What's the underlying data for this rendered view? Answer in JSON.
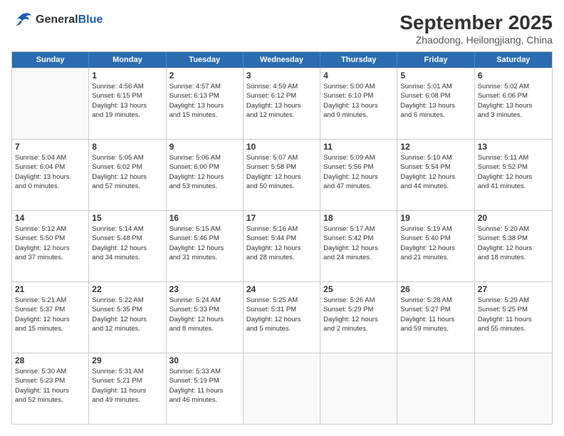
{
  "logo": {
    "general": "General",
    "blue": "Blue"
  },
  "title": "September 2025",
  "subtitle": "Zhaodong, Heilongjiang, China",
  "days_of_week": [
    "Sunday",
    "Monday",
    "Tuesday",
    "Wednesday",
    "Thursday",
    "Friday",
    "Saturday"
  ],
  "weeks": [
    [
      {
        "day": "",
        "info": ""
      },
      {
        "day": "1",
        "info": "Sunrise: 4:56 AM\nSunset: 6:15 PM\nDaylight: 13 hours\nand 19 minutes."
      },
      {
        "day": "2",
        "info": "Sunrise: 4:57 AM\nSunset: 6:13 PM\nDaylight: 13 hours\nand 15 minutes."
      },
      {
        "day": "3",
        "info": "Sunrise: 4:59 AM\nSunset: 6:12 PM\nDaylight: 13 hours\nand 12 minutes."
      },
      {
        "day": "4",
        "info": "Sunrise: 5:00 AM\nSunset: 6:10 PM\nDaylight: 13 hours\nand 9 minutes."
      },
      {
        "day": "5",
        "info": "Sunrise: 5:01 AM\nSunset: 6:08 PM\nDaylight: 13 hours\nand 6 minutes."
      },
      {
        "day": "6",
        "info": "Sunrise: 5:02 AM\nSunset: 6:06 PM\nDaylight: 13 hours\nand 3 minutes."
      }
    ],
    [
      {
        "day": "7",
        "info": "Sunrise: 5:04 AM\nSunset: 6:04 PM\nDaylight: 13 hours\nand 0 minutes."
      },
      {
        "day": "8",
        "info": "Sunrise: 5:05 AM\nSunset: 6:02 PM\nDaylight: 12 hours\nand 57 minutes."
      },
      {
        "day": "9",
        "info": "Sunrise: 5:06 AM\nSunset: 6:00 PM\nDaylight: 12 hours\nand 53 minutes."
      },
      {
        "day": "10",
        "info": "Sunrise: 5:07 AM\nSunset: 5:58 PM\nDaylight: 12 hours\nand 50 minutes."
      },
      {
        "day": "11",
        "info": "Sunrise: 5:09 AM\nSunset: 5:56 PM\nDaylight: 12 hours\nand 47 minutes."
      },
      {
        "day": "12",
        "info": "Sunrise: 5:10 AM\nSunset: 5:54 PM\nDaylight: 12 hours\nand 44 minutes."
      },
      {
        "day": "13",
        "info": "Sunrise: 5:11 AM\nSunset: 5:52 PM\nDaylight: 12 hours\nand 41 minutes."
      }
    ],
    [
      {
        "day": "14",
        "info": "Sunrise: 5:12 AM\nSunset: 5:50 PM\nDaylight: 12 hours\nand 37 minutes."
      },
      {
        "day": "15",
        "info": "Sunrise: 5:14 AM\nSunset: 5:48 PM\nDaylight: 12 hours\nand 34 minutes."
      },
      {
        "day": "16",
        "info": "Sunrise: 5:15 AM\nSunset: 5:46 PM\nDaylight: 12 hours\nand 31 minutes."
      },
      {
        "day": "17",
        "info": "Sunrise: 5:16 AM\nSunset: 5:44 PM\nDaylight: 12 hours\nand 28 minutes."
      },
      {
        "day": "18",
        "info": "Sunrise: 5:17 AM\nSunset: 5:42 PM\nDaylight: 12 hours\nand 24 minutes."
      },
      {
        "day": "19",
        "info": "Sunrise: 5:19 AM\nSunset: 5:40 PM\nDaylight: 12 hours\nand 21 minutes."
      },
      {
        "day": "20",
        "info": "Sunrise: 5:20 AM\nSunset: 5:38 PM\nDaylight: 12 hours\nand 18 minutes."
      }
    ],
    [
      {
        "day": "21",
        "info": "Sunrise: 5:21 AM\nSunset: 5:37 PM\nDaylight: 12 hours\nand 15 minutes."
      },
      {
        "day": "22",
        "info": "Sunrise: 5:22 AM\nSunset: 5:35 PM\nDaylight: 12 hours\nand 12 minutes."
      },
      {
        "day": "23",
        "info": "Sunrise: 5:24 AM\nSunset: 5:33 PM\nDaylight: 12 hours\nand 8 minutes."
      },
      {
        "day": "24",
        "info": "Sunrise: 5:25 AM\nSunset: 5:31 PM\nDaylight: 12 hours\nand 5 minutes."
      },
      {
        "day": "25",
        "info": "Sunrise: 5:26 AM\nSunset: 5:29 PM\nDaylight: 12 hours\nand 2 minutes."
      },
      {
        "day": "26",
        "info": "Sunrise: 5:28 AM\nSunset: 5:27 PM\nDaylight: 11 hours\nand 59 minutes."
      },
      {
        "day": "27",
        "info": "Sunrise: 5:29 AM\nSunset: 5:25 PM\nDaylight: 11 hours\nand 55 minutes."
      }
    ],
    [
      {
        "day": "28",
        "info": "Sunrise: 5:30 AM\nSunset: 5:23 PM\nDaylight: 11 hours\nand 52 minutes."
      },
      {
        "day": "29",
        "info": "Sunrise: 5:31 AM\nSunset: 5:21 PM\nDaylight: 11 hours\nand 49 minutes."
      },
      {
        "day": "30",
        "info": "Sunrise: 5:33 AM\nSunset: 5:19 PM\nDaylight: 11 hours\nand 46 minutes."
      },
      {
        "day": "",
        "info": ""
      },
      {
        "day": "",
        "info": ""
      },
      {
        "day": "",
        "info": ""
      },
      {
        "day": "",
        "info": ""
      }
    ]
  ]
}
